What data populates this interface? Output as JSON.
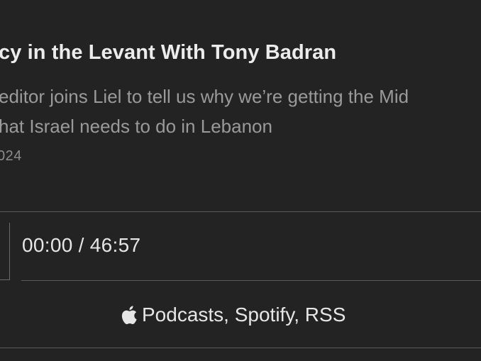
{
  "episode": {
    "title": "cy in the Levant With Tony Badran",
    "description_line1": "editor joins Liel to tell us why we’re getting the Mid",
    "description_line2": "hat Israel needs to do in Lebanon",
    "date": "024"
  },
  "player": {
    "time_display": "00:00 / 46:57"
  },
  "subscribe": {
    "links_text": "Podcasts, Spotify, RSS",
    "icon": "apple-icon"
  },
  "colors": {
    "background": "#232323",
    "text": "#e8e8e8",
    "muted": "#9a9a9a",
    "divider": "#5a5a5a"
  }
}
